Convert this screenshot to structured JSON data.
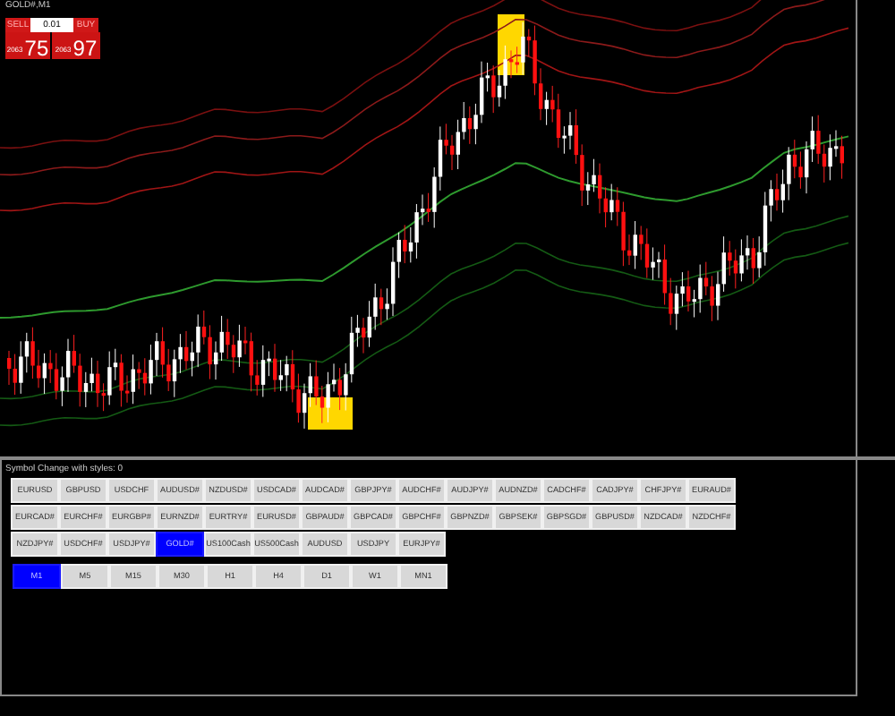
{
  "chart": {
    "header": "GOLD#,M1"
  },
  "trade_panel": {
    "sell_label": "SELL",
    "buy_label": "BUY",
    "lot": "0.01",
    "sell_price_prefix": "2063",
    "sell_price_main": "75",
    "buy_price_prefix": "2063",
    "buy_price_main": "97"
  },
  "symbol_panel": {
    "title": "Symbol Change with styles: 0",
    "symbol_rows": [
      [
        {
          "label": "EURUSD",
          "selected": false
        },
        {
          "label": "GBPUSD",
          "selected": false
        },
        {
          "label": "USDCHF",
          "selected": false
        },
        {
          "label": "AUDUSD#",
          "selected": false
        },
        {
          "label": "NZDUSD#",
          "selected": false
        },
        {
          "label": "USDCAD#",
          "selected": false
        },
        {
          "label": "AUDCAD#",
          "selected": false
        },
        {
          "label": "GBPJPY#",
          "selected": false
        },
        {
          "label": "AUDCHF#",
          "selected": false
        },
        {
          "label": "AUDJPY#",
          "selected": false
        },
        {
          "label": "AUDNZD#",
          "selected": false
        },
        {
          "label": "CADCHF#",
          "selected": false
        },
        {
          "label": "CADJPY#",
          "selected": false
        },
        {
          "label": "CHFJPY#",
          "selected": false
        },
        {
          "label": "EURAUD#",
          "selected": false
        }
      ],
      [
        {
          "label": "EURCAD#",
          "selected": false
        },
        {
          "label": "EURCHF#",
          "selected": false
        },
        {
          "label": "EURGBP#",
          "selected": false
        },
        {
          "label": "EURNZD#",
          "selected": false
        },
        {
          "label": "EURTRY#",
          "selected": false
        },
        {
          "label": "EURUSD#",
          "selected": false
        },
        {
          "label": "GBPAUD#",
          "selected": false
        },
        {
          "label": "GBPCAD#",
          "selected": false
        },
        {
          "label": "GBPCHF#",
          "selected": false
        },
        {
          "label": "GBPNZD#",
          "selected": false
        },
        {
          "label": "GBPSEK#",
          "selected": false
        },
        {
          "label": "GBPSGD#",
          "selected": false
        },
        {
          "label": "GBPUSD#",
          "selected": false
        },
        {
          "label": "NZDCAD#",
          "selected": false
        },
        {
          "label": "NZDCHF#",
          "selected": false
        }
      ],
      [
        {
          "label": "NZDJPY#",
          "selected": false
        },
        {
          "label": "USDCHF#",
          "selected": false
        },
        {
          "label": "USDJPY#",
          "selected": false
        },
        {
          "label": "GOLD#",
          "selected": true
        },
        {
          "label": "US100Cash",
          "selected": false
        },
        {
          "label": "US500Cash",
          "selected": false
        },
        {
          "label": "AUDUSD",
          "selected": false
        },
        {
          "label": "USDJPY",
          "selected": false
        },
        {
          "label": "EURJPY#",
          "selected": false
        }
      ]
    ],
    "timeframes": [
      {
        "label": "M1",
        "selected": true
      },
      {
        "label": "M5",
        "selected": false
      },
      {
        "label": "M15",
        "selected": false
      },
      {
        "label": "M30",
        "selected": false
      },
      {
        "label": "H1",
        "selected": false
      },
      {
        "label": "H4",
        "selected": false
      },
      {
        "label": "D1",
        "selected": false
      },
      {
        "label": "W1",
        "selected": false
      },
      {
        "label": "MN1",
        "selected": false
      }
    ]
  }
}
